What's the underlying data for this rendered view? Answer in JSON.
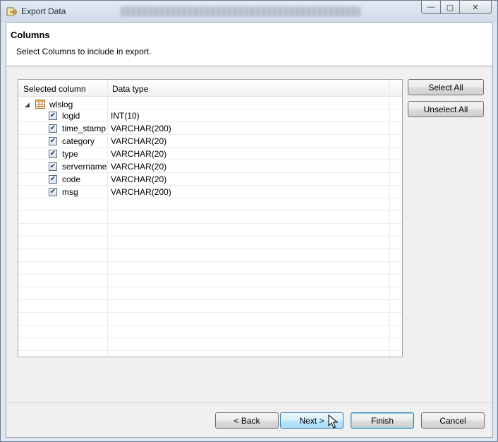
{
  "window": {
    "title": "Export Data",
    "subtitle_blurred": "",
    "controls": {
      "minimize": "—",
      "maximize": "▢",
      "close": "✕"
    }
  },
  "header": {
    "title": "Columns",
    "description": "Select Columns to include in export."
  },
  "table": {
    "columns": [
      "Selected column",
      "Data type"
    ],
    "group": {
      "name": "wlslog",
      "expanded": true
    },
    "rows": [
      {
        "name": "logid",
        "type": "INT(10)",
        "checked": true
      },
      {
        "name": "time_stamp",
        "type": "VARCHAR(200)",
        "checked": true
      },
      {
        "name": "category",
        "type": "VARCHAR(20)",
        "checked": true
      },
      {
        "name": "type",
        "type": "VARCHAR(20)",
        "checked": true
      },
      {
        "name": "servername",
        "type": "VARCHAR(20)",
        "checked": true
      },
      {
        "name": "code",
        "type": "VARCHAR(20)",
        "checked": true
      },
      {
        "name": "msg",
        "type": "VARCHAR(200)",
        "checked": true
      }
    ]
  },
  "side_buttons": {
    "select_all": "Select All",
    "unselect_all": "Unselect All"
  },
  "footer": {
    "back": "< Back",
    "next": "Next >",
    "finish": "Finish",
    "cancel": "Cancel"
  },
  "colors": {
    "accent": "#3c7fb1",
    "hover": "#bee6fd"
  }
}
